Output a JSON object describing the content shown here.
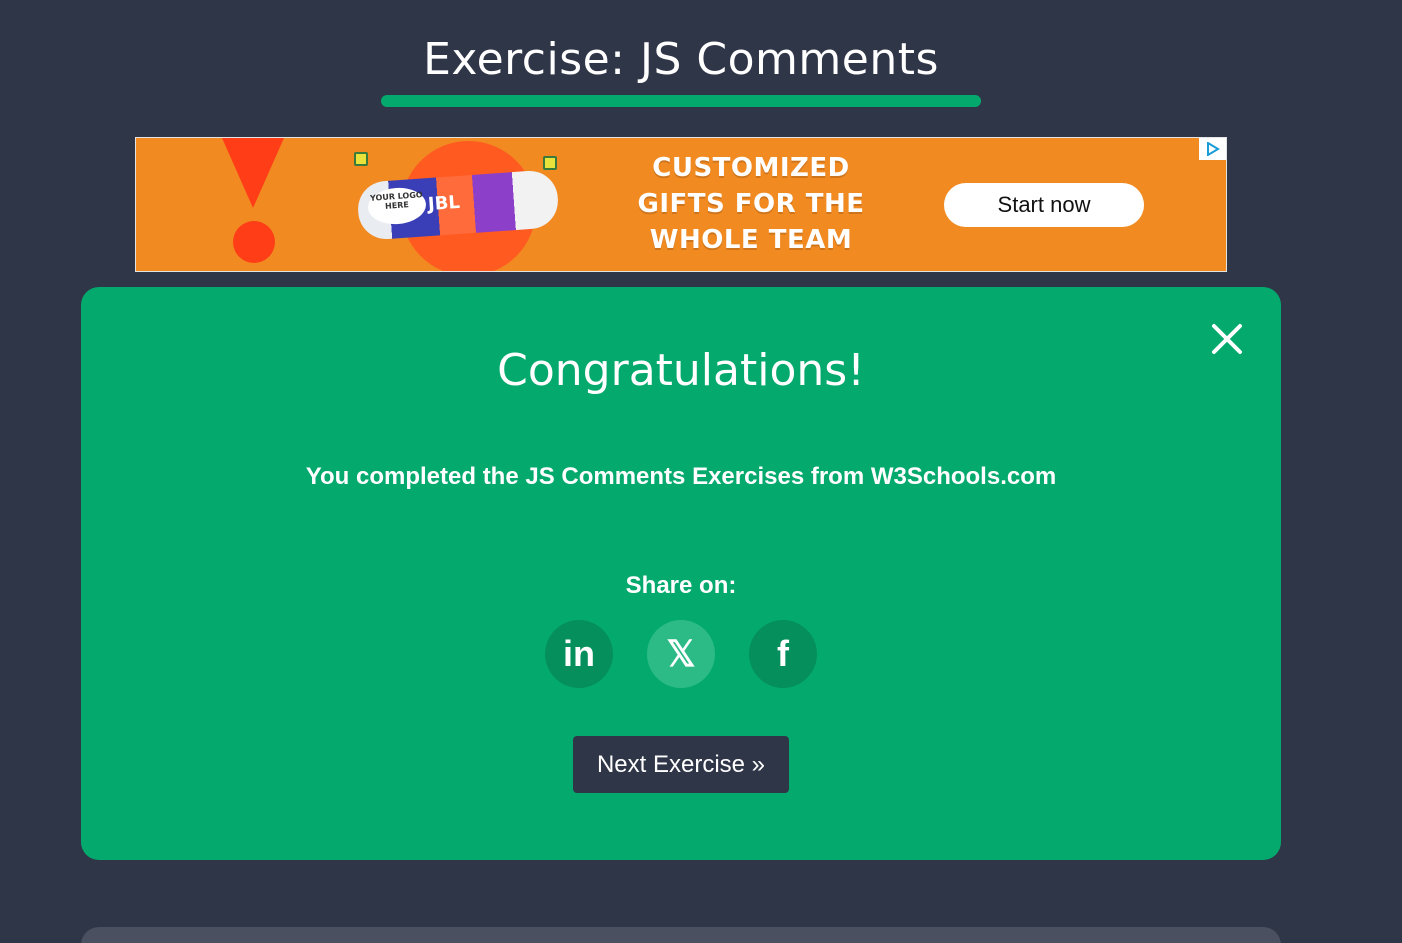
{
  "page": {
    "title": "Exercise: JS Comments"
  },
  "ad": {
    "speaker_logo_text": "YOUR LOGO HERE",
    "speaker_brand": "JBL",
    "headline_line1": "CUSTOMIZED",
    "headline_line2": "GIFTS FOR THE",
    "headline_line3": "WHOLE TEAM",
    "cta_label": "Start now",
    "colors": {
      "background": "#f28a22",
      "accent": "#ff3d17"
    }
  },
  "modal": {
    "title": "Congratulations!",
    "message": "You completed the JS Comments Exercises from W3Schools.com",
    "share_label": "Share on:",
    "share_buttons": [
      {
        "name": "linkedin",
        "glyph": "in"
      },
      {
        "name": "x",
        "glyph": "𝕏"
      },
      {
        "name": "facebook",
        "glyph": "f"
      }
    ],
    "next_button_label": "Next Exercise »",
    "colors": {
      "background": "#04aa6d",
      "button": "#2f3648"
    }
  }
}
